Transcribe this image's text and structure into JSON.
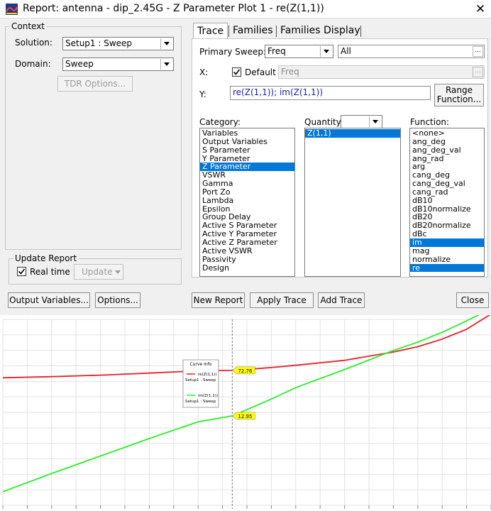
{
  "window": {
    "title": "Report: antenna - dip_2.45G - Z Parameter Plot 1 - re(Z(1,1))",
    "close_glyph": "✕"
  },
  "context": {
    "legend": "Context",
    "solution_label": "Solution:",
    "solution_value": "Setup1 : Sweep",
    "domain_label": "Domain:",
    "domain_value": "Sweep",
    "tdr_button": "TDR Options..."
  },
  "update_report": {
    "legend": "Update Report",
    "realtime_label": "Real time",
    "realtime_checked": true,
    "update_button": "Update"
  },
  "tabs": [
    {
      "label": "Trace",
      "active": true
    },
    {
      "label": "Families",
      "active": false
    },
    {
      "label": "Families Display",
      "active": false
    }
  ],
  "trace": {
    "primary_sweep_label": "Primary Sweep:",
    "primary_sweep_value": "Freq",
    "primary_sweep_range": "All",
    "x_label": "X:",
    "x_default_label": "Default",
    "x_default_checked": true,
    "x_value": "Freq",
    "y_label": "Y:",
    "y_value": "re(Z(1,1)); im(Z(1,1))",
    "range_function_label": [
      "Range",
      "Function..."
    ],
    "category_label": "Category:",
    "quantity_label": "Quantity:",
    "function_label": "Function:",
    "categories": [
      "Variables",
      "Output Variables",
      "S Parameter",
      "Y Parameter",
      "Z Parameter",
      "VSWR",
      "Gamma",
      "Port Zo",
      "Lambda",
      "Epsilon",
      "Group Delay",
      "Active S Parameter",
      "Active Y Parameter",
      "Active Z Parameter",
      "Active VSWR",
      "Passivity",
      "Design"
    ],
    "selected_category": "Z Parameter",
    "quantities": [
      "Z(1,1)"
    ],
    "selected_quantity": "Z(1,1)",
    "functions": [
      "<none>",
      "ang_deg",
      "ang_deg_val",
      "ang_rad",
      "arg",
      "cang_deg",
      "cang_deg_val",
      "cang_rad",
      "dB10",
      "dB10normalize",
      "dB20",
      "dB20normalize",
      "dBc",
      "im",
      "mag",
      "normalize",
      "re"
    ],
    "selected_functions": [
      "im",
      "re"
    ]
  },
  "buttons": {
    "output_variables": "Output Variables...",
    "options": "Options...",
    "new_report": "New Report",
    "apply_trace": "Apply Trace",
    "add_trace": "Add Trace",
    "close": "Close"
  },
  "chart_data": {
    "type": "line",
    "legend": {
      "title": "Curve Info",
      "placement": "upper-left-center",
      "entries": [
        {
          "name": "re(Z(1,1))",
          "sub": "Setup1 : Sweep",
          "color": "#e8202a"
        },
        {
          "name": "im(Z(1,1))",
          "sub": "Setup1 : Sweep",
          "color": "#2aee2a"
        }
      ]
    },
    "grid": true,
    "xlim": [
      0,
      1
    ],
    "ylim": [
      -105,
      140
    ],
    "series": [
      {
        "name": "re(Z(1,1))",
        "color": "#e8202a",
        "x": [
          0,
          0.1,
          0.2,
          0.3,
          0.4,
          0.47,
          0.55,
          0.6,
          0.7,
          0.8,
          0.85,
          0.9,
          0.95,
          1.0
        ],
        "y": [
          63,
          64.5,
          66.5,
          69.2,
          72.2,
          72.8,
          76.5,
          79.5,
          86,
          97,
          104,
          114,
          127,
          147
        ]
      },
      {
        "name": "im(Z(1,1))",
        "color": "#2aee2a",
        "x": [
          0,
          0.1,
          0.2,
          0.3,
          0.4,
          0.47,
          0.55,
          0.6,
          0.7,
          0.8,
          0.85,
          0.9,
          0.95,
          1.0
        ],
        "y": [
          -87,
          -63,
          -40,
          -17,
          5,
          12.95,
          35,
          50,
          74,
          99,
          110,
          123,
          138,
          154
        ]
      }
    ],
    "marker": {
      "x": 0.47,
      "labels": [
        {
          "text": "72.76",
          "y": 72.8,
          "color": "#ffff00"
        },
        {
          "text": "12.95",
          "y": 12.95,
          "color": "#ffff00"
        }
      ]
    }
  },
  "colors": {
    "dialog_bg": "#f0f0f0",
    "selection": "#0078d7",
    "y_text": "#1a1aa8",
    "grid": "#e2e2e2",
    "marker_fill": "#ffff00"
  },
  "icons": {
    "app": "hfss-app-icon",
    "close": "close-icon",
    "dropdown": "chevron-down-icon",
    "check": "check-icon",
    "ellipsis": "ellipsis-icon"
  }
}
